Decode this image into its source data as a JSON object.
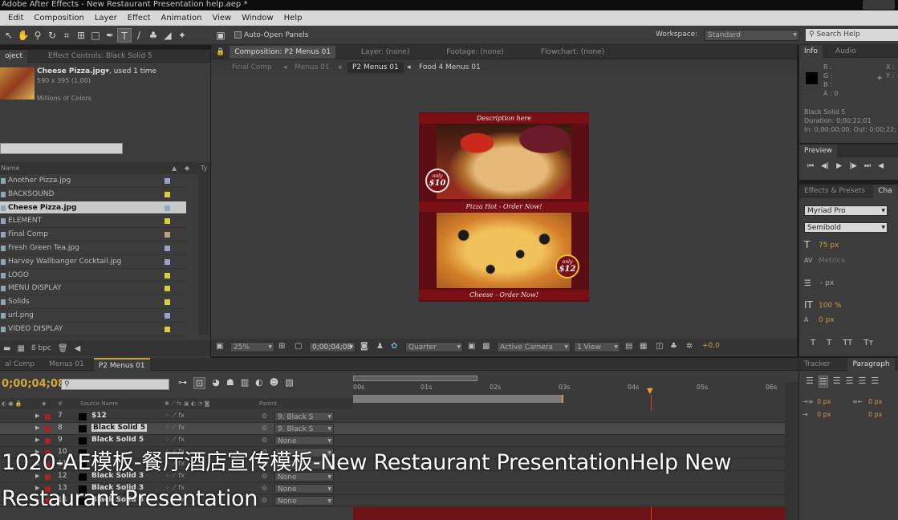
{
  "window": {
    "title": "Adobe After Effects - New Restaurant Presentation help.aep *"
  },
  "menu": [
    "Edit",
    "Composition",
    "Layer",
    "Effect",
    "Animation",
    "View",
    "Window",
    "Help"
  ],
  "toolbar": {
    "auto_open": "Auto-Open Panels",
    "workspace_label": "Workspace:",
    "workspace_value": "Standard",
    "search_placeholder": "Search Help"
  },
  "project": {
    "tab_project": "oject",
    "tab_effects": "Effect Controls: Black Solid 5",
    "preview_name": "Cheese Pizza.jpg▾",
    "preview_used": ", used 1 time",
    "preview_dims": "590 x 395 (1,00)",
    "preview_colors": "Millions of Colors",
    "col_name": "Name",
    "items": [
      {
        "name": "Another Pizza.jpg",
        "color": "#9aa2c8"
      },
      {
        "name": "BACKSOUND",
        "color": "#d8d03a"
      },
      {
        "name": "Cheese Pizza.jpg",
        "color": "#9aa2c8"
      },
      {
        "name": "ELEMENT",
        "color": "#d8d03a"
      },
      {
        "name": "Final Comp",
        "color": "#b8a676"
      },
      {
        "name": "Fresh Green Tea.jpg",
        "color": "#9aa2c8"
      },
      {
        "name": "Harvey Wallbanger Cocktail.jpg",
        "color": "#9aa2c8"
      },
      {
        "name": "LOGO",
        "color": "#d8d03a"
      },
      {
        "name": "MENU DISPLAY",
        "color": "#d8d03a"
      },
      {
        "name": "Solids",
        "color": "#d8d03a"
      },
      {
        "name": "url.png",
        "color": "#9aa2c8"
      },
      {
        "name": "VIDEO DISPLAY",
        "color": "#d8d03a"
      }
    ],
    "bpc": "8 bpc"
  },
  "comp": {
    "tab_comp": "Composition: P2 Menus 01",
    "tab_layer": "Layer: (none)",
    "tab_footage": "Footage: (none)",
    "tab_flow": "Flowchart: (none)",
    "crumbs": [
      "Final Comp",
      "Menus 01",
      "P2 Menus 01",
      "Food 4 Menus 01"
    ],
    "zoom": "25%",
    "timecode": "0;00;04;08",
    "resolution": "Quarter",
    "camera": "Active Camera",
    "views": "1 View",
    "exposure": "+0,0",
    "card": {
      "top": "Description here",
      "mid": "Pizza Hot - Order Now!",
      "bottom": "Cheese - Order Now!",
      "badge1_top": "only",
      "badge1_price": "$10",
      "badge2_top": "only",
      "badge2_price": "$12"
    }
  },
  "info": {
    "tab_info": "Info",
    "tab_audio": "Audio",
    "r": "R :",
    "g": "G :",
    "b": "B :",
    "a": "A : 0",
    "x": "X :",
    "y": "Y :",
    "layer": "Black Solid 5",
    "duration": "Duration: 0;00;22;01",
    "inout": "In: 0;00;00;00, Out: 0;00;22;"
  },
  "preview": {
    "tab": "Preview"
  },
  "effects": {
    "tab": "Effects & Presets",
    "tab2": "Cha"
  },
  "character": {
    "font": "Myriad Pro",
    "style": "Semibold",
    "size": "75 px",
    "metrics": "Metrics",
    "leading": "- px",
    "scale": "100 %",
    "baseline": "0 px"
  },
  "timeline": {
    "tabs": [
      "al Comp",
      "Menus 01",
      "P2 Menus 01"
    ],
    "timecode": "0;00;04;08",
    "col_source": "Source Name",
    "col_parent": "Parent",
    "ruler": [
      "00s",
      "01s",
      "02s",
      "03s",
      "04s",
      "05s",
      "06s"
    ],
    "layers": [
      {
        "num": "7",
        "name": "$12",
        "parent": "9. Black S"
      },
      {
        "num": "8",
        "name": "Black Solid 5",
        "parent": "9. Black S"
      },
      {
        "num": "9",
        "name": "Black Solid 5",
        "parent": "None"
      },
      {
        "num": "10",
        "name": "",
        "parent": ""
      },
      {
        "num": "11",
        "name": "",
        "parent": ""
      },
      {
        "num": "12",
        "name": "Black Solid 3",
        "parent": "None"
      },
      {
        "num": "13",
        "name": "Black Solid 3",
        "parent": "None"
      },
      {
        "num": "14",
        "name": "Black Solid 3",
        "parent": "None"
      }
    ]
  },
  "tracker": {
    "tab": "Tracker",
    "tab2": "Paragraph",
    "v1": "0 px",
    "v2": "0 px",
    "v3": "0 px",
    "v4": "0 px"
  },
  "caption": {
    "line1": "1020-AE模板-餐厅酒店宣传模板-New Restaurant PresentationHelp New",
    "line2": "Restaurant Presentation"
  }
}
